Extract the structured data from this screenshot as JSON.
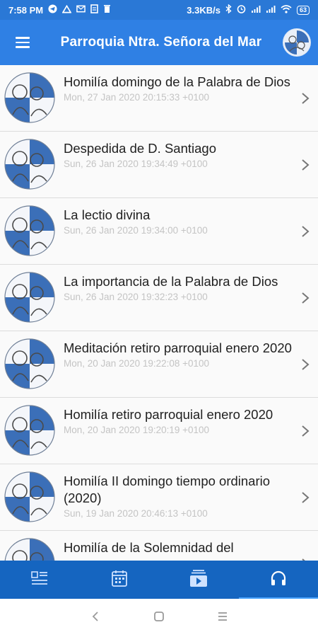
{
  "status_bar": {
    "time": "7:58 PM",
    "left_icons": [
      "telegram-icon",
      "notification-icon",
      "mail-icon",
      "document-icon",
      "trash-icon"
    ],
    "network_speed": "3.3KB/s",
    "right_icons": [
      "bluetooth-icon",
      "alarm-icon",
      "signal-icon",
      "signal-icon",
      "wifi-icon"
    ],
    "battery": "63"
  },
  "app_bar": {
    "title": "Parroquia Ntra. Señora del Mar"
  },
  "colors": {
    "status_bar": "#2a78d6",
    "app_bar": "#2f80e4",
    "bottom_nav": "#1565c0",
    "title_text": "#212121",
    "date_text": "#c4c4c4"
  },
  "list": {
    "items": [
      {
        "title": "Homilía domingo de la Palabra de Dios",
        "date": "Mon, 27 Jan 2020 20:15:33 +0100"
      },
      {
        "title": "Despedida de D. Santiago",
        "date": "Sun, 26 Jan 2020 19:34:49 +0100"
      },
      {
        "title": "La lectio divina",
        "date": "Sun, 26 Jan 2020 19:34:00 +0100"
      },
      {
        "title": "La importancia de la Palabra de Dios",
        "date": "Sun, 26 Jan 2020 19:32:23 +0100"
      },
      {
        "title": "Meditación retiro parroquial enero 2020",
        "date": "Mon, 20 Jan 2020 19:22:08 +0100"
      },
      {
        "title": "Homilía retiro parroquial enero 2020",
        "date": "Mon, 20 Jan 2020 19:20:19 +0100"
      },
      {
        "title": "Homilía II domingo tiempo ordinario (2020)",
        "date": "Sun, 19 Jan 2020 20:46:13 +0100"
      },
      {
        "title": "Homilía de la Solemnidad del",
        "date": ""
      }
    ]
  },
  "bottom_nav": {
    "tabs": [
      {
        "icon": "news-icon",
        "active": false
      },
      {
        "icon": "calendar-icon",
        "active": false
      },
      {
        "icon": "video-icon",
        "active": false
      },
      {
        "icon": "headphones-icon",
        "active": true
      }
    ]
  },
  "system_nav": {
    "buttons": [
      "back-icon",
      "home-icon",
      "recents-icon"
    ]
  }
}
